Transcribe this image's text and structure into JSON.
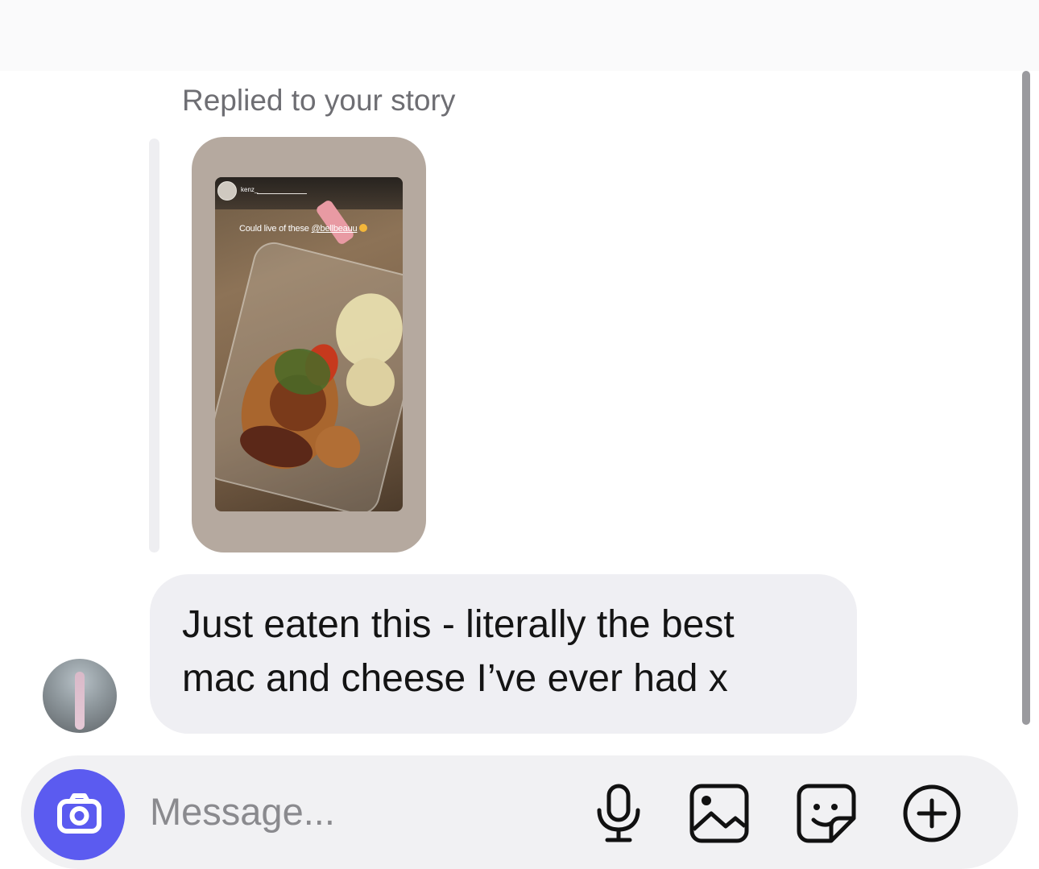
{
  "thread": {
    "reply_label": "Replied to your story",
    "story": {
      "username": "kenz_",
      "caption": "Could live of these",
      "mention": "@bellbeauu"
    },
    "message": {
      "lines": [
        "Just eaten this - literally the best",
        "mac and cheese I’ve ever had x"
      ]
    }
  },
  "composer": {
    "placeholder": "Message...",
    "icons": [
      "camera-icon",
      "microphone-icon",
      "gallery-icon",
      "sticker-icon",
      "add-icon"
    ]
  },
  "colors": {
    "accent": "#5b5bf0",
    "bubble": "#efeff3",
    "story_frame": "#b5a99f"
  }
}
